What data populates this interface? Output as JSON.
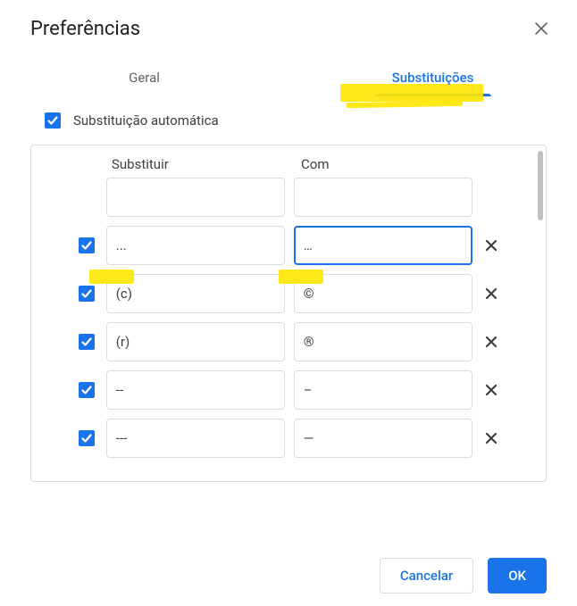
{
  "dialog": {
    "title": "Preferências",
    "tabs": {
      "general": "Geral",
      "subs": "Substituições"
    },
    "active_tab": "subs",
    "auto_sub_label": "Substituição automática",
    "auto_sub_checked": true,
    "columns": {
      "replace": "Substituir",
      "with": "Com"
    },
    "rows": [
      {
        "checked": null,
        "from": "",
        "to": "",
        "focused": false,
        "deletable": false
      },
      {
        "checked": true,
        "from": "...",
        "to": "…",
        "focused": true,
        "deletable": true,
        "highlighted": true
      },
      {
        "checked": true,
        "from": "(c)",
        "to": "©",
        "focused": false,
        "deletable": true
      },
      {
        "checked": true,
        "from": "(r)",
        "to": "®",
        "focused": false,
        "deletable": true
      },
      {
        "checked": true,
        "from": "--",
        "to": "–",
        "focused": false,
        "deletable": true
      },
      {
        "checked": true,
        "from": "---",
        "to": "—",
        "focused": false,
        "deletable": true
      }
    ],
    "buttons": {
      "cancel": "Cancelar",
      "ok": "OK"
    }
  }
}
